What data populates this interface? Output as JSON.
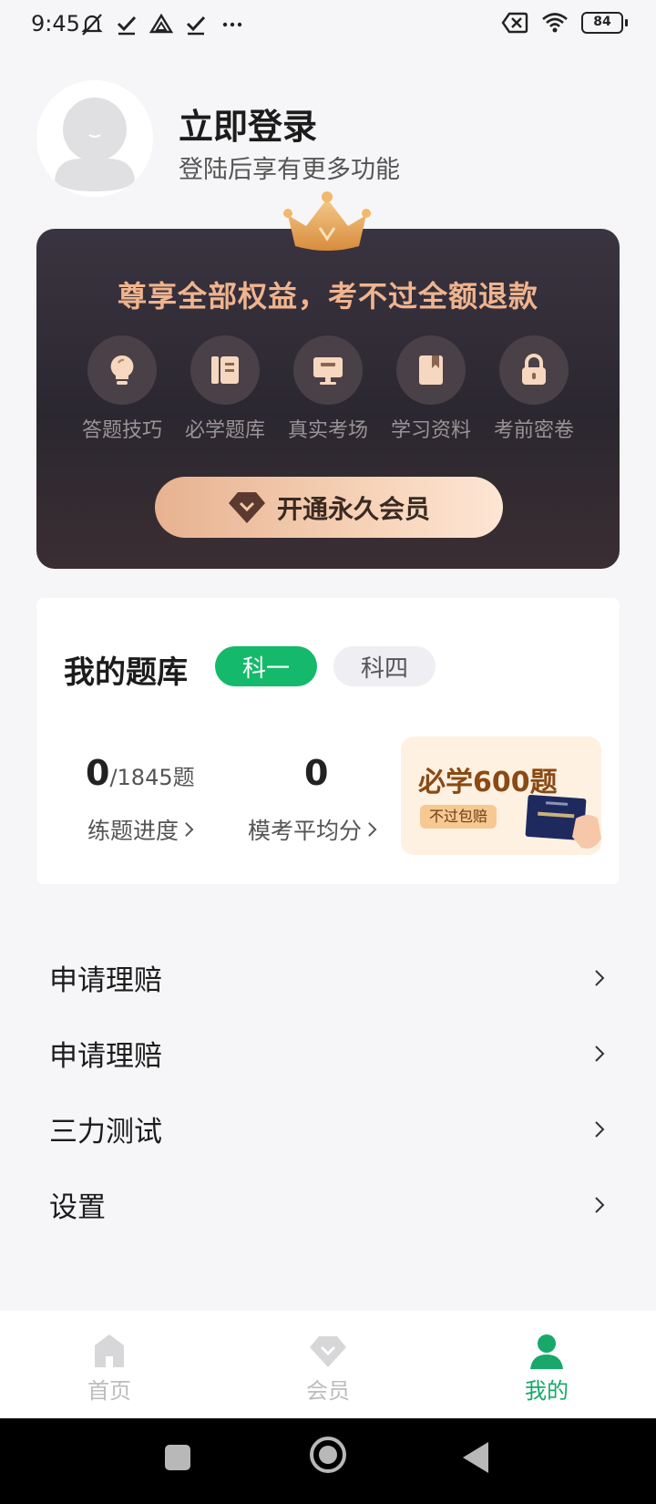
{
  "status_bar": {
    "time": "9:45",
    "battery": "84",
    "icons": [
      "mute-icon",
      "check-icon",
      "drive-icon",
      "check-icon",
      "more-icon",
      "close-box-icon",
      "wifi-icon",
      "battery-icon"
    ]
  },
  "profile": {
    "title": "立即登录",
    "subtitle": "登陆后享有更多功能"
  },
  "vip": {
    "slogan": "尊享全部权益，考不过全额退款",
    "benefits": [
      {
        "label": "答题技巧",
        "icon": "lightbulb-icon"
      },
      {
        "label": "必学题库",
        "icon": "question-bank-icon"
      },
      {
        "label": "真实考场",
        "icon": "exam-monitor-icon"
      },
      {
        "label": "学习资料",
        "icon": "bookmark-book-icon"
      },
      {
        "label": "考前密卷",
        "icon": "lock-icon"
      }
    ],
    "button_label": "开通永久会员",
    "colors": {
      "slogan": "#f0b48e",
      "button_start": "#e7b290",
      "button_end": "#fde6d4"
    }
  },
  "bank": {
    "title": "我的题库",
    "tabs": [
      {
        "label": "科一",
        "active": true
      },
      {
        "label": "科四",
        "active": false
      }
    ],
    "progress": {
      "value": "0",
      "total": "/1845题",
      "label": "练题进度"
    },
    "mock": {
      "value": "0",
      "label": "模考平均分"
    },
    "promo": {
      "title": "必学600题",
      "badge": "不过包赔"
    },
    "accent": "#15b96b"
  },
  "menu": [
    {
      "label": "申请理赔"
    },
    {
      "label": "申请理赔"
    },
    {
      "label": "三力测试"
    },
    {
      "label": "设置"
    }
  ],
  "bottom_nav": [
    {
      "label": "首页",
      "icon": "home-icon",
      "active": false
    },
    {
      "label": "会员",
      "icon": "diamond-icon",
      "active": false
    },
    {
      "label": "我的",
      "icon": "person-icon",
      "active": true
    }
  ]
}
